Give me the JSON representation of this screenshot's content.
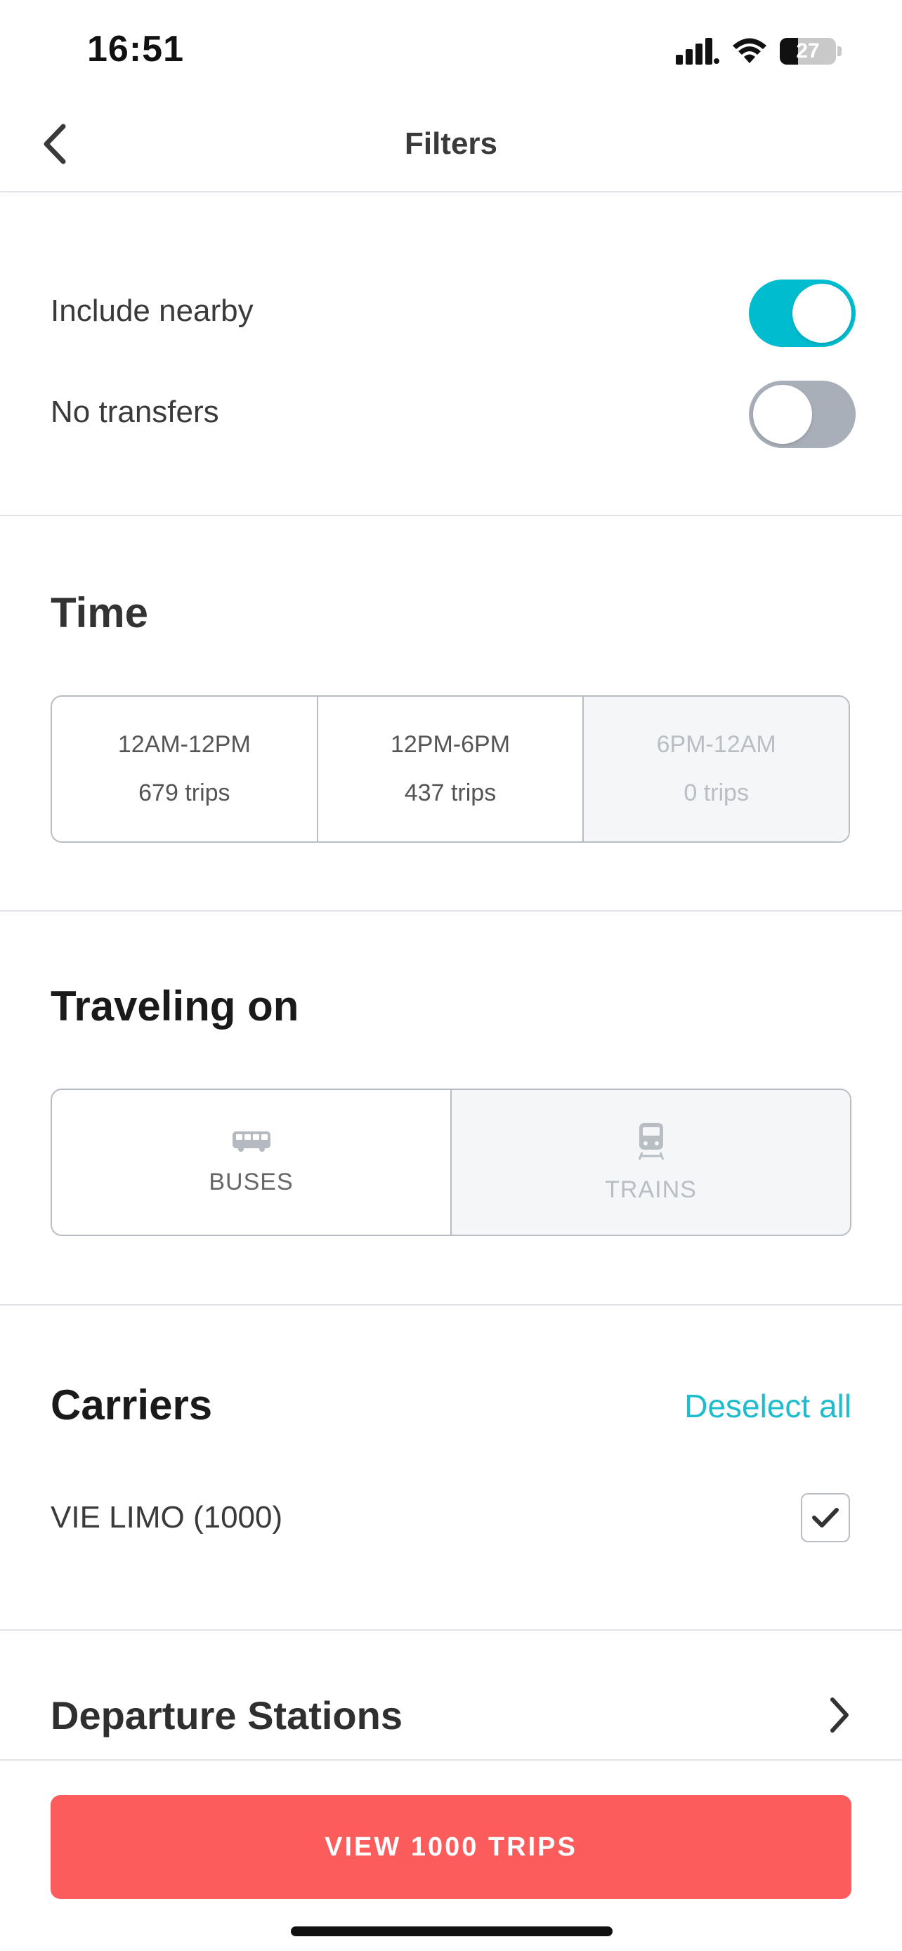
{
  "status_bar": {
    "time": "16:51",
    "battery": "27"
  },
  "header": {
    "title": "Filters"
  },
  "options": {
    "include_nearby": {
      "label": "Include nearby",
      "state": "on"
    },
    "no_transfers": {
      "label": "No transfers",
      "state": "off"
    }
  },
  "time": {
    "title": "Time",
    "segments": [
      {
        "label": "12AM-12PM",
        "count": "679 trips",
        "enabled": true
      },
      {
        "label": "12PM-6PM",
        "count": "437 trips",
        "enabled": true
      },
      {
        "label": "6PM-12AM",
        "count": "0 trips",
        "enabled": false
      }
    ]
  },
  "traveling_on": {
    "title": "Traveling on",
    "modes": [
      {
        "label": "BUSES",
        "icon": "bus-icon",
        "enabled": true
      },
      {
        "label": "TRAINS",
        "icon": "train-icon",
        "enabled": false
      }
    ]
  },
  "carriers": {
    "title": "Carriers",
    "deselect_label": "Deselect all",
    "items": [
      {
        "label": "VIE LIMO (1000)",
        "checked": true
      }
    ]
  },
  "departure_stations": {
    "title": "Departure Stations"
  },
  "cta": {
    "label": "VIEW 1000 TRIPS"
  },
  "colors": {
    "accent": "#00bccf",
    "cta": "#fd5c5c",
    "toggle_off": "#a9afb8"
  }
}
